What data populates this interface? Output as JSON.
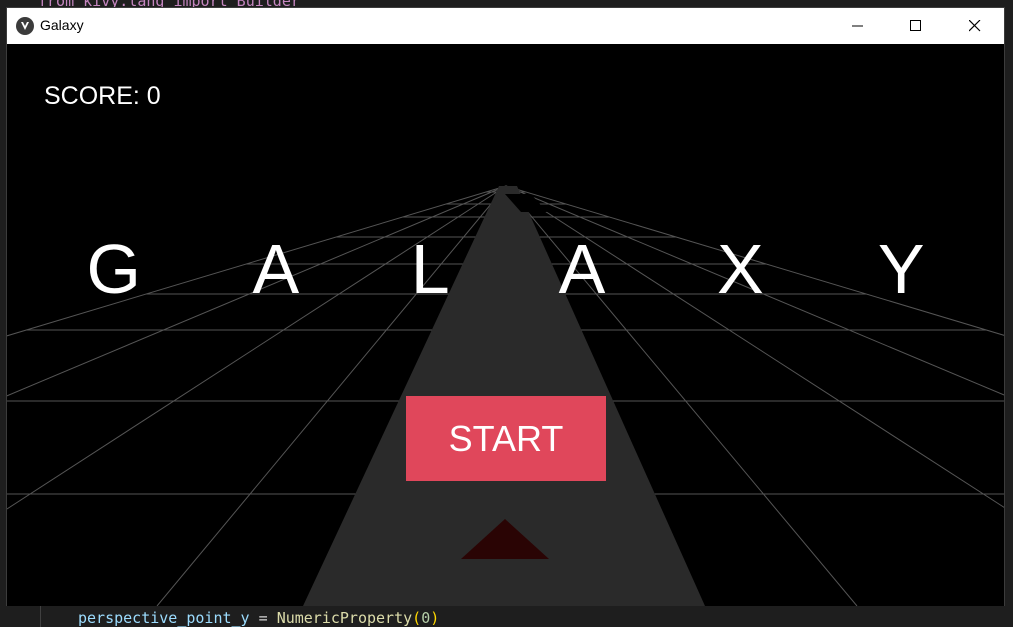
{
  "window": {
    "title": "Galaxy",
    "controls": [
      "minimize",
      "maximize",
      "close"
    ]
  },
  "game": {
    "score_text": "SCORE: 0",
    "title_text": "G A L A X Y",
    "start_label": "START"
  },
  "background_code": {
    "top_line": "from kivy.lang import Builder",
    "bottom_line": {
      "name": "perspective_point_y",
      "op": " = ",
      "fn": "NumericProperty",
      "open": "(",
      "arg": "0",
      "close": ")"
    }
  },
  "colors": {
    "start_button": "#e0475b",
    "track": "#2a2a2a",
    "ship": "#2a0404",
    "grid_lines": "#555555"
  }
}
